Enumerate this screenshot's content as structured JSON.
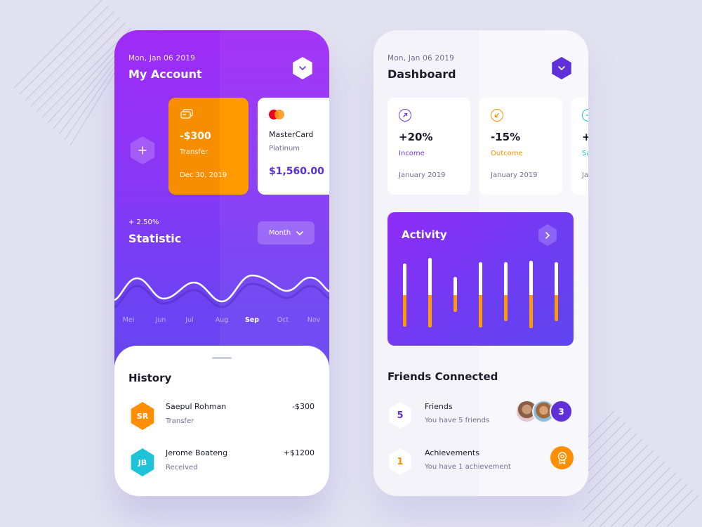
{
  "account": {
    "date": "Mon, Jan 06 2019",
    "title": "My Account",
    "menu_icon": "chevron-down-icon",
    "add_icon": "plus-icon",
    "cards": [
      {
        "type": "transfer",
        "icon": "cards-icon",
        "amount": "-$300",
        "label": "Transfer",
        "date": "Dec 30, 2019",
        "color": "#ff9a00"
      },
      {
        "type": "mastercard",
        "icon": "mastercard-logo",
        "name": "MasterCard",
        "tier": "Platinum",
        "balance": "$1,560.00"
      }
    ],
    "statistic": {
      "change": "+ 2.50%",
      "title": "Statistic",
      "period_select": "Month",
      "months": [
        "Mei",
        "Jun",
        "Jul",
        "Aug",
        "Sep",
        "Oct",
        "Nov"
      ],
      "active_month": "Sep"
    },
    "history": {
      "title": "History",
      "items": [
        {
          "initials": "SR",
          "name": "Saepul Rohman",
          "type": "Transfer",
          "amount": "-$300",
          "color": "#ff8f00"
        },
        {
          "initials": "JB",
          "name": "Jerome Boateng",
          "type": "Received",
          "amount": "+$1200",
          "color": "#1ec3d8"
        }
      ]
    }
  },
  "dashboard": {
    "date": "Mon, Jan 06 2019",
    "title": "Dashboard",
    "menu_icon": "chevron-down-icon",
    "kpis": [
      {
        "icon": "arrow-up-right-icon",
        "value": "+20%",
        "label": "Income",
        "period": "January 2019",
        "color": "#6c3ce6"
      },
      {
        "icon": "arrow-down-left-icon",
        "value": "-15%",
        "label": "Outcome",
        "period": "January 2019",
        "color": "#ff8f00"
      },
      {
        "icon": "arrow-right-icon",
        "value": "+",
        "label": "Sa",
        "period": "Ja",
        "color": "#1ec3d8"
      }
    ],
    "activity": {
      "title": "Activity",
      "next_icon": "chevron-right-icon",
      "bars": [
        {
          "total": 0.78,
          "filled": 0.39
        },
        {
          "total": 0.86,
          "filled": 0.4
        },
        {
          "total": 0.44,
          "filled": 0.21
        },
        {
          "total": 0.81,
          "filled": 0.4
        },
        {
          "total": 0.73,
          "filled": 0.32
        },
        {
          "total": 0.84,
          "filled": 0.41
        },
        {
          "total": 0.73,
          "filled": 0.32
        }
      ]
    },
    "friends": {
      "title": "Friends Connected",
      "items": [
        {
          "count": "5",
          "name": "Friends",
          "desc": "You have 5 friends",
          "color": "#5f2fd8",
          "extra": "3"
        },
        {
          "count": "1",
          "name": "Achievements",
          "desc": "You have 1 achievement",
          "color": "#ff8f00",
          "extra_icon": "award-icon"
        }
      ]
    }
  }
}
